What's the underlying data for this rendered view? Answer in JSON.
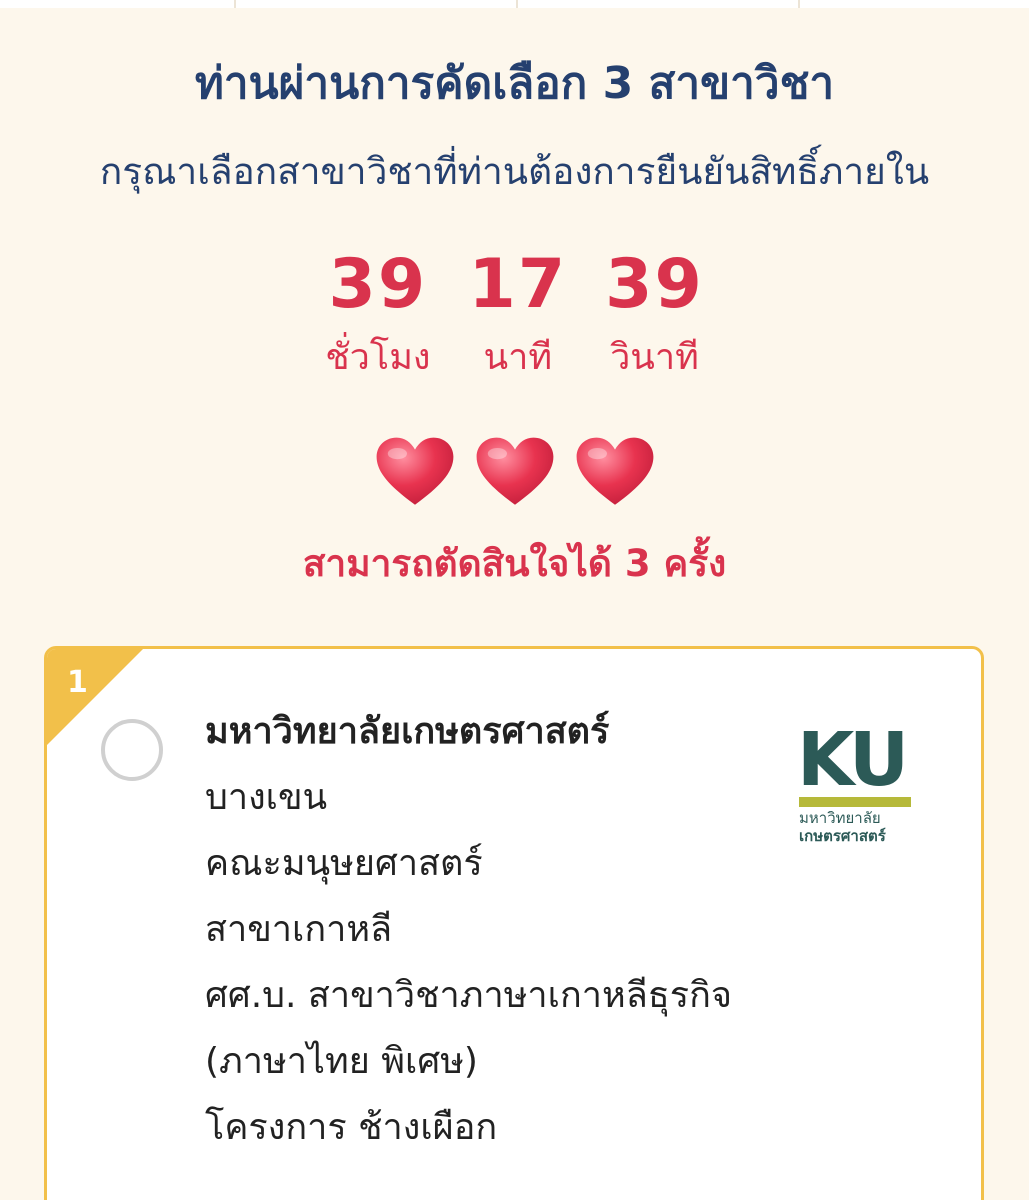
{
  "header": {
    "title": "ท่านผ่านการคัดเลือก 3 สาขาวิชา",
    "subtitle": "กรุณาเลือกสาขาวิชาที่ท่านต้องการยืนยันสิทธิ์ภายใน"
  },
  "countdown": {
    "hours": "39",
    "hours_label": "ชั่วโมง",
    "minutes": "17",
    "minutes_label": "นาที",
    "seconds": "39",
    "seconds_label": "วินาที"
  },
  "hearts": {
    "count": 3,
    "icon": "heart-icon",
    "color": "#e8334f"
  },
  "chances_text": "สามารถตัดสินใจได้ 3 ครั้ง",
  "choices": [
    {
      "rank": "1",
      "university": "มหาวิทยาลัยเกษตรศาสตร์",
      "campus": "บางเขน",
      "faculty": "คณะมนุษยศาสตร์",
      "major": "สาขาเกาหลี",
      "program": "ศศ.บ. สาขาวิชาภาษาเกาหลีธุรกิจ",
      "program_note": "(ภาษาไทย พิเศษ)",
      "project": "โครงการ ช้างเผือก",
      "selected": false,
      "logo": {
        "letters": "KU",
        "line1": "มหาวิทยาลัย",
        "line2": "เกษตรศาสตร์"
      }
    }
  ],
  "colors": {
    "title": "#25406f",
    "accent": "#d9334d",
    "card_border": "#f2c04a",
    "background": "#fdf7ec",
    "logo_green": "#2c5a57",
    "logo_lime": "#b6b93a"
  }
}
